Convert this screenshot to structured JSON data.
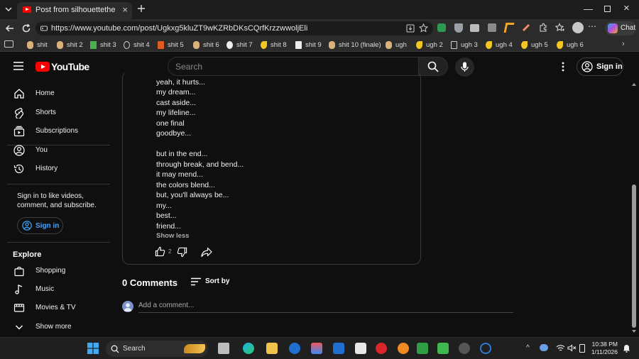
{
  "browser": {
    "tab_title": "Post from silhouettetheguy - YouTube",
    "url": "https://www.youtube.com/post/Ugkxg5kluZT9wKZRbDKsCQrfKrzzwwoljEli",
    "chat_label": "Chat"
  },
  "bookmarks": [
    {
      "label": "shit"
    },
    {
      "label": "shit 2"
    },
    {
      "label": "shit 3"
    },
    {
      "label": "shit 4"
    },
    {
      "label": "shit 5"
    },
    {
      "label": "shit 6"
    },
    {
      "label": "shit 7"
    },
    {
      "label": "shit 8"
    },
    {
      "label": "shit 9"
    },
    {
      "label": "shit 10 (finale)"
    },
    {
      "label": "ugh"
    },
    {
      "label": "ugh 2"
    },
    {
      "label": "ugh 3"
    },
    {
      "label": "ugh 4"
    },
    {
      "label": "ugh 5"
    },
    {
      "label": "ugh 6"
    }
  ],
  "youtube": {
    "logo_text": "YouTube",
    "search_placeholder": "Search",
    "sign_in_label": "Sign in"
  },
  "sidebar": {
    "main_items": [
      {
        "label": "Home"
      },
      {
        "label": "Shorts"
      },
      {
        "label": "Subscriptions"
      },
      {
        "label": "You"
      },
      {
        "label": "History"
      }
    ],
    "signin_note": "Sign in to like videos, comment, and subscribe.",
    "signin_label": "Sign in",
    "explore_heading": "Explore",
    "explore_items": [
      {
        "label": "Shopping"
      },
      {
        "label": "Music"
      },
      {
        "label": "Movies & TV"
      },
      {
        "label": "Show more"
      }
    ]
  },
  "post": {
    "lines": [
      "yeah, it hurts...",
      "my dream...",
      "cast aside...",
      "my lifeline...",
      "one final",
      "goodbye...",
      "but in the end...",
      "through break, and bend...",
      "it may mend...",
      "the colors blend...",
      "but, you'll always be...",
      "my...",
      "best...",
      "friend..."
    ],
    "show_less": "Show less",
    "like_count": "2"
  },
  "comments": {
    "count_label": "0 Comments",
    "sort_label": "Sort by",
    "input_placeholder": "Add a comment..."
  },
  "taskbar": {
    "search_label": "Search",
    "time": "10:38 PM",
    "date": "1/11/2026"
  },
  "colors": {
    "background": "#0f0f0f",
    "youtube_red": "#ff0000",
    "link_blue": "#3ea6ff"
  }
}
